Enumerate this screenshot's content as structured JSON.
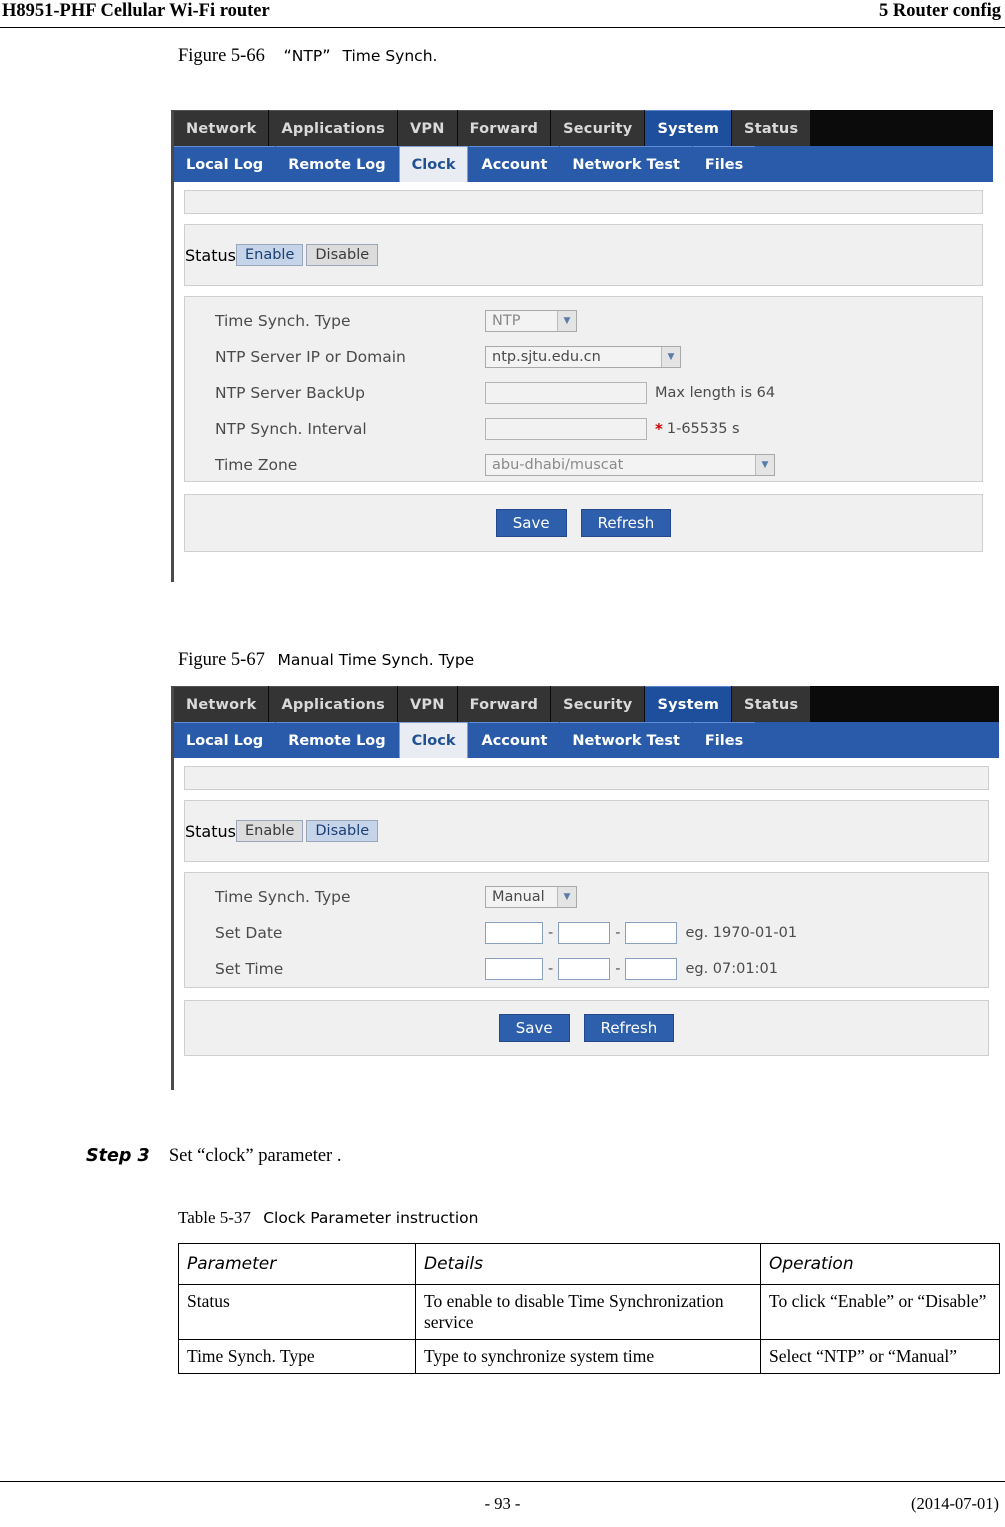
{
  "header": {
    "left": "H8951-PHF Cellular Wi-Fi router",
    "right": "5 Router config"
  },
  "footer": {
    "page": "- 93 -",
    "date": "(2014-07-01)"
  },
  "figure66": {
    "caption_prefix": "Figure 5-66",
    "caption_quote_open": "“",
    "caption_name": "NTP",
    "caption_quote_close": "”",
    "caption_suffix": "Time Synch.",
    "menu": [
      {
        "label": "Network",
        "active": false
      },
      {
        "label": "Applications",
        "active": false
      },
      {
        "label": "VPN",
        "active": false
      },
      {
        "label": "Forward",
        "active": false
      },
      {
        "label": "Security",
        "active": false
      },
      {
        "label": "System",
        "active": true
      },
      {
        "label": "Status",
        "active": false
      }
    ],
    "submenu": [
      {
        "label": "Local Log",
        "active": false
      },
      {
        "label": "Remote Log",
        "active": false
      },
      {
        "label": "Clock",
        "active": true
      },
      {
        "label": "Account",
        "active": false
      },
      {
        "label": "Network Test",
        "active": false
      },
      {
        "label": "Files",
        "active": false
      }
    ],
    "status_label": "Status",
    "status_enable": "Enable",
    "status_disable": "Disable",
    "rows": {
      "time_synch_type_label": "Time Synch. Type",
      "time_synch_type_value": "NTP",
      "ntp_server_label": "NTP Server IP or Domain",
      "ntp_server_value": "ntp.sjtu.edu.cn",
      "ntp_backup_label": "NTP Server BackUp",
      "ntp_backup_value": "",
      "ntp_backup_hint": "Max length is 64",
      "ntp_interval_label": "NTP Synch. Interval",
      "ntp_interval_value": "",
      "ntp_interval_star": "*",
      "ntp_interval_hint": "1-65535 s",
      "time_zone_label": "Time Zone",
      "time_zone_value": "abu-dhabi/muscat"
    },
    "save_label": "Save",
    "refresh_label": "Refresh"
  },
  "figure67": {
    "caption_prefix": "Figure 5-67",
    "caption_name": "Manual Time Synch. Type",
    "menu": [
      {
        "label": "Network",
        "active": false
      },
      {
        "label": "Applications",
        "active": false
      },
      {
        "label": "VPN",
        "active": false
      },
      {
        "label": "Forward",
        "active": false
      },
      {
        "label": "Security",
        "active": false
      },
      {
        "label": "System",
        "active": true
      },
      {
        "label": "Status",
        "active": false
      }
    ],
    "submenu": [
      {
        "label": "Local Log",
        "active": false
      },
      {
        "label": "Remote Log",
        "active": false
      },
      {
        "label": "Clock",
        "active": true
      },
      {
        "label": "Account",
        "active": false
      },
      {
        "label": "Network Test",
        "active": false
      },
      {
        "label": "Files",
        "active": false
      }
    ],
    "status_label": "Status",
    "status_enable": "Enable",
    "status_disable": "Disable",
    "rows": {
      "time_synch_type_label": "Time Synch. Type",
      "time_synch_type_value": "Manual",
      "set_date_label": "Set Date",
      "set_date_sep": "-",
      "set_date_hint": "eg. 1970-01-01",
      "set_time_label": "Set Time",
      "set_time_sep": "-",
      "set_time_hint": "eg. 07:01:01"
    },
    "save_label": "Save",
    "refresh_label": "Refresh"
  },
  "step": {
    "label": "Step 3",
    "text": "Set “clock” parameter ."
  },
  "table": {
    "caption_prefix": "Table 5-37",
    "caption_name": "Clock Parameter instruction",
    "headers": [
      "Parameter",
      "Details",
      "Operation"
    ],
    "rows": [
      {
        "parameter": "Status",
        "details": "To enable to disable Time Synchronization service",
        "operation": "To click “Enable” or “Disable”"
      },
      {
        "parameter": "Time Synch. Type",
        "details": "Type to synchronize system time",
        "operation": "Select “NTP” or “Manual”"
      }
    ]
  }
}
